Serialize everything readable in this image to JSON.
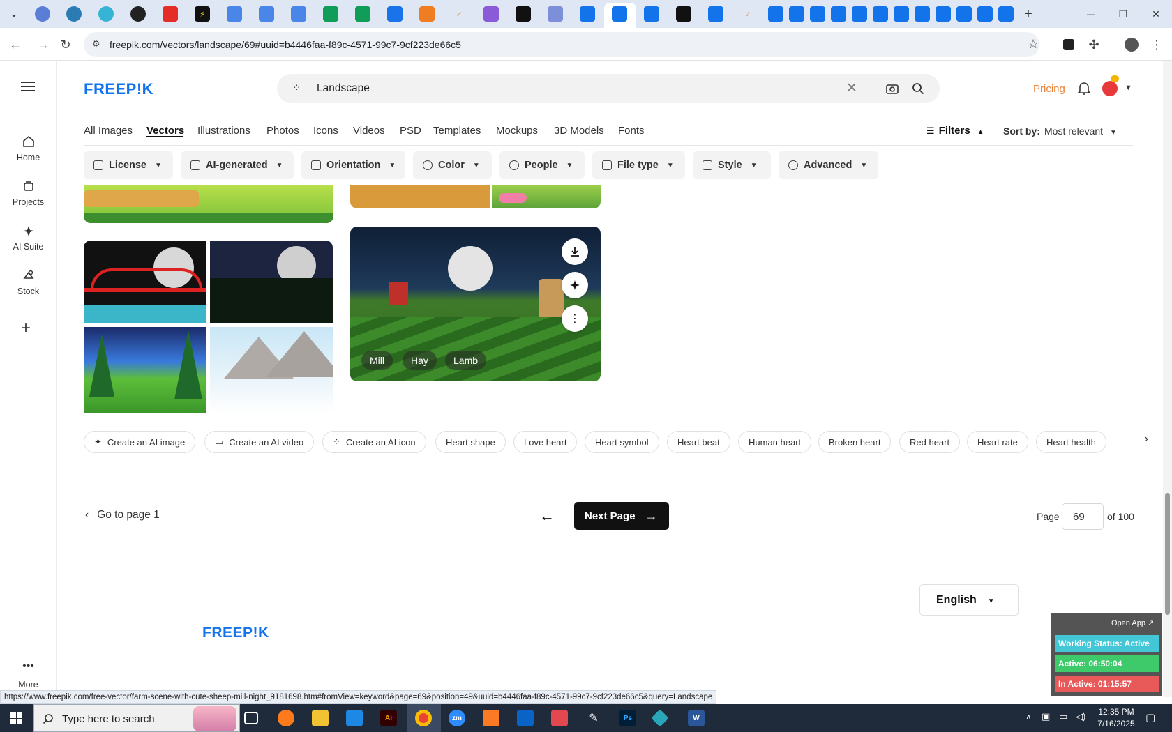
{
  "browser": {
    "url": "freepik.com/vectors/landscape/69#uuid=b4446faa-f89c-4571-99c7-9cf223de66c5",
    "status_url": "https://www.freepik.com/free-vector/farm-scene-with-cute-sheep-mill-night_9181698.htm#fromView=keyword&page=69&position=49&uuid=b4446faa-f89c-4571-99c7-9cf223de66c5&query=Landscape",
    "win_minimize": "—",
    "win_restore": "❐",
    "win_close": "✕",
    "new_tab": "+"
  },
  "site": {
    "logo": "FREEP!K",
    "search_query": "Landscape",
    "pricing": "Pricing",
    "left_nav": [
      {
        "label": "Home",
        "icon": "home-icon"
      },
      {
        "label": "Projects",
        "icon": "projects-icon"
      },
      {
        "label": "AI Suite",
        "icon": "ai-suite-icon"
      },
      {
        "label": "Stock",
        "icon": "stock-icon"
      },
      {
        "label": "More",
        "icon": "more-icon"
      }
    ],
    "categories": [
      "All Images",
      "Vectors",
      "Illustrations",
      "Photos",
      "Icons",
      "Videos",
      "PSD",
      "Templates",
      "Mockups",
      "3D Models",
      "Fonts"
    ],
    "active_category": "Vectors",
    "filters_label": "Filters",
    "sort_label": "Sort by:",
    "sort_value": "Most relevant",
    "filter_chips": [
      "License",
      "AI-generated",
      "Orientation",
      "Color",
      "People",
      "File type",
      "Style",
      "Advanced"
    ],
    "image_tags": [
      "Mill",
      "Hay",
      "Lamb"
    ],
    "keyword_chips": [
      "Create an AI image",
      "Create an AI video",
      "Create an AI icon",
      "Heart shape",
      "Love heart",
      "Heart symbol",
      "Heart beat",
      "Human heart",
      "Broken heart",
      "Red heart",
      "Heart rate",
      "Heart health"
    ],
    "pagination": {
      "go_first": "Go to page 1",
      "next": "Next Page",
      "page_label": "Page",
      "current_page": "69",
      "total": "of 100"
    },
    "language": "English"
  },
  "tracker": {
    "open_app": "Open App ↗",
    "working_status": "Working Status: Active",
    "active": "Active: 06:50:04",
    "inactive": "In Active: 01:15:57"
  },
  "taskbar": {
    "search_placeholder": "Type here to search",
    "time": "12:35 PM",
    "date": "7/16/2025"
  },
  "colors": {
    "brand_blue": "#1273eb",
    "pricing_orange": "#e8833a",
    "tracker_green": "#3ec96a",
    "tracker_cyan": "#43c6d6",
    "tracker_red": "#e8595a"
  }
}
